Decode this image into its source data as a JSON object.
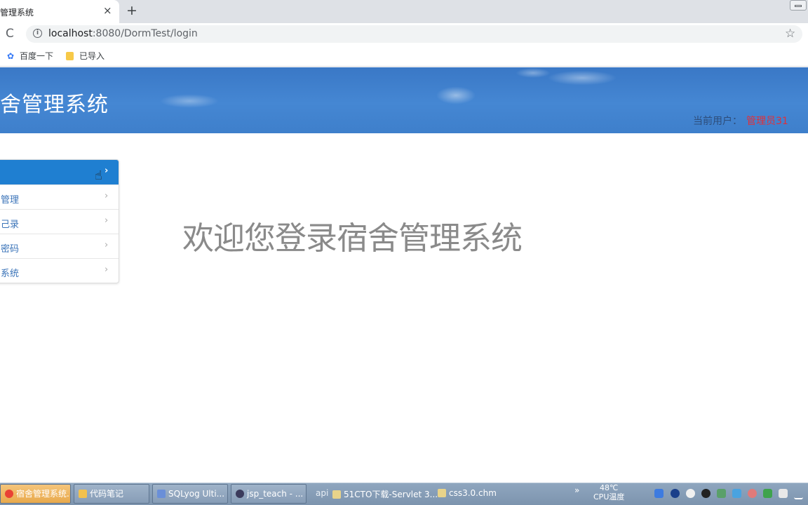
{
  "browser": {
    "tab_title": "管理系统",
    "tab_close": "×",
    "new_tab": "+",
    "url_host": "localhost",
    "url_rest": ":8080/DormTest/login",
    "bookmarks": [
      {
        "label": "百度一下",
        "icon": "baidu-paw-icon"
      },
      {
        "label": "已导入",
        "icon": "folder-icon"
      }
    ]
  },
  "header": {
    "site_title": "舍管理系统",
    "user_label": "当前用户：",
    "user_name": "管理员31"
  },
  "menu": {
    "items": [
      {
        "label": "",
        "active": true
      },
      {
        "label": "管理",
        "active": false
      },
      {
        "label": "己录",
        "active": false
      },
      {
        "label": "密码",
        "active": false
      },
      {
        "label": "系统",
        "active": false
      }
    ],
    "chevron": "›"
  },
  "main": {
    "welcome": "欢迎您登录宿舍管理系统"
  },
  "taskbar": {
    "tasks": [
      {
        "label": "宿舍管理系统..."
      },
      {
        "label": "代码笔记"
      },
      {
        "label": "SQLyog Ulti..."
      },
      {
        "label": "jsp_teach - ..."
      }
    ],
    "api": "api",
    "doc1": "51CTO下载-Servlet 3....",
    "doc2": "css3.0.chm",
    "overflow": "»",
    "temp_value": "48℃",
    "temp_label": "CPU温度"
  },
  "colors": {
    "header_blue": "#4587d3",
    "menu_active": "#1f7fd1",
    "user_name": "#e0303a"
  }
}
